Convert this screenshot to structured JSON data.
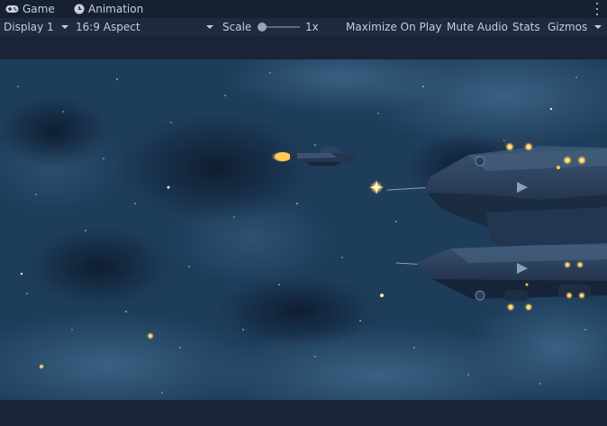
{
  "tabs": [
    {
      "label": "Game",
      "icon": "gamepad-icon"
    },
    {
      "label": "Animation",
      "icon": "animation-clock-icon"
    }
  ],
  "toolbar": {
    "display": "Display 1",
    "aspect": "16:9 Aspect",
    "scale_label": "Scale",
    "scale_value": "1x",
    "maximize": "Maximize On Play",
    "mute": "Mute Audio",
    "stats": "Stats",
    "gizmos": "Gizmos"
  },
  "scale_slider_level": 0.05,
  "colors": {
    "window_bg": "#1a2436",
    "tabbar_bg": "#16202f",
    "toolbar_bg": "#1e2a3d",
    "sky": "#1d3d5c",
    "engine_glow": "#ffc857"
  },
  "scene": {
    "description_icons": [
      "player-ship-icon",
      "enemy-mothership-icon",
      "star-sparkle-icon",
      "nebula-cloud-icon"
    ]
  }
}
